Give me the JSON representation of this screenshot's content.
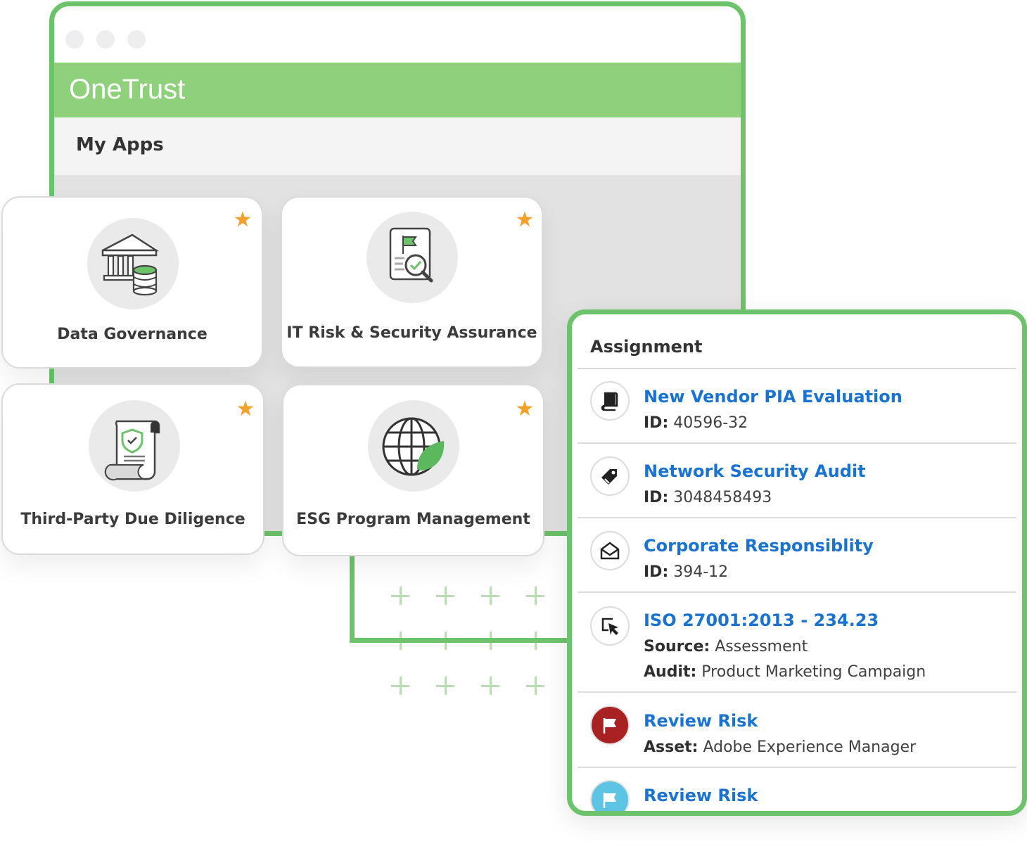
{
  "brand": {
    "name": "OneTrust",
    "colors": {
      "accent_green": "#6cc36a",
      "header_green": "#8fd07a",
      "link_blue": "#1a73d1",
      "star": "#f4a12b"
    }
  },
  "window": {
    "dots": [
      "window-dot",
      "window-dot",
      "window-dot"
    ],
    "section_title": "My Apps"
  },
  "apps": [
    {
      "name": "Data Governance",
      "icon": "bank-database-icon",
      "favorite": true
    },
    {
      "name": "IT Risk & Security Assurance",
      "icon": "report-magnifier-icon",
      "favorite": true
    },
    {
      "name": "Third-Party Due Diligence",
      "icon": "shield-scroll-icon",
      "favorite": true
    },
    {
      "name": "ESG Program Management",
      "icon": "globe-leaf-icon",
      "favorite": true
    }
  ],
  "assignment": {
    "title": "Assignment",
    "items": [
      {
        "icon": "book-icon",
        "title": "New Vendor PIA Evaluation",
        "lines": [
          {
            "label": "ID:",
            "value": "40596-32"
          }
        ]
      },
      {
        "icon": "tag-icon",
        "title": "Network Security Audit",
        "lines": [
          {
            "label": "ID:",
            "value": "3048458493"
          }
        ]
      },
      {
        "icon": "envelope-open-icon",
        "title": "Corporate Responsiblity",
        "lines": [
          {
            "label": "ID:",
            "value": "394-12"
          }
        ]
      },
      {
        "icon": "pointer-select-icon",
        "title": "ISO 27001:2013 - 234.23",
        "lines": [
          {
            "label": "Source:",
            "value": " Assessment"
          },
          {
            "label": "Audit:",
            "value": "Product Marketing Campaign"
          }
        ]
      },
      {
        "icon": "flag-icon",
        "status_color": "#a82222",
        "title": "Review Risk",
        "lines": [
          {
            "label": "Asset:",
            "value": "Adobe Experience Manager"
          }
        ]
      },
      {
        "icon": "flag-icon",
        "status_color": "#5ec4e4",
        "title": "Review Risk",
        "lines": []
      }
    ]
  }
}
